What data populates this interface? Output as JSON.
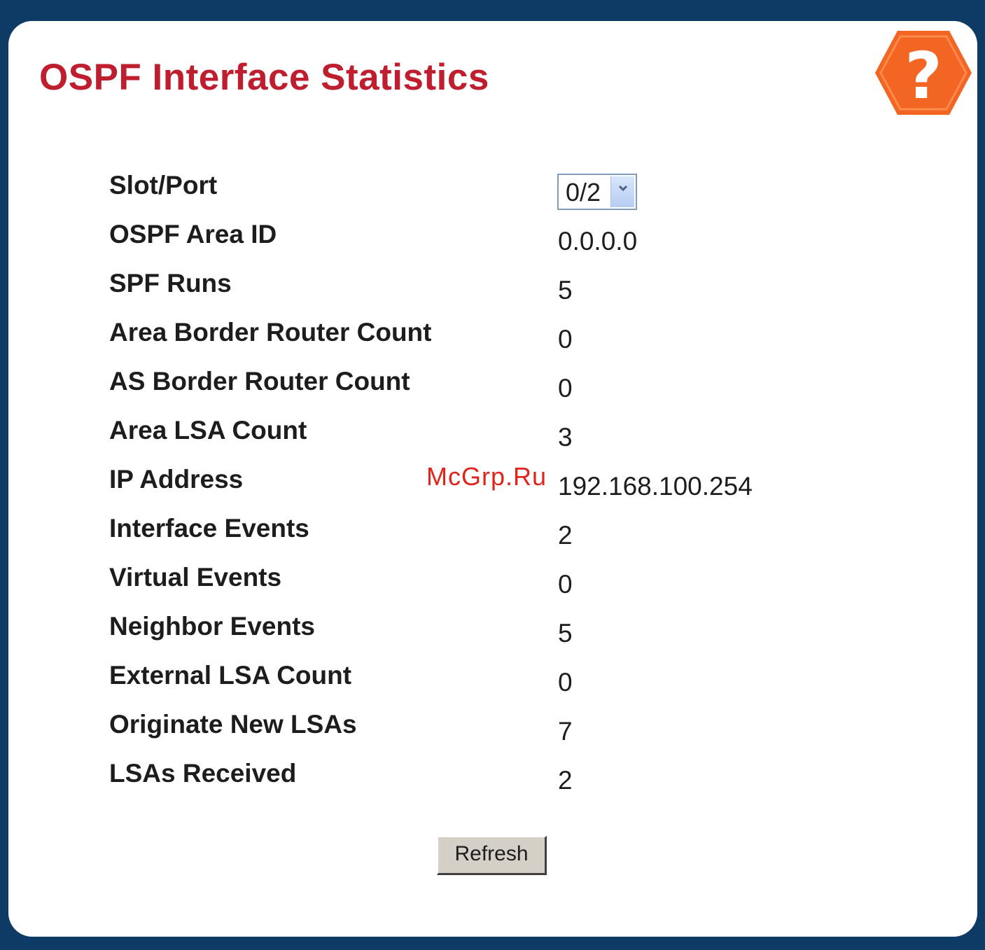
{
  "page": {
    "title": "OSPF Interface Statistics",
    "accent_color": "#bf1e2e",
    "frame_color": "#0e3a66",
    "help_icon": "help-question-icon",
    "help_glyph": "?",
    "help_color": "#f26522"
  },
  "slot_port": {
    "label": "Slot/Port",
    "selected": "0/2"
  },
  "stats": [
    {
      "label": "OSPF Area ID",
      "value": "0.0.0.0"
    },
    {
      "label": "SPF Runs",
      "value": "5"
    },
    {
      "label": "Area Border Router Count",
      "value": "0"
    },
    {
      "label": "AS Border Router Count",
      "value": "0"
    },
    {
      "label": "Area LSA Count",
      "value": "3"
    },
    {
      "label": "IP Address",
      "value": "192.168.100.254"
    },
    {
      "label": "Interface Events",
      "value": "2"
    },
    {
      "label": "Virtual Events",
      "value": "0"
    },
    {
      "label": "Neighbor Events",
      "value": "5"
    },
    {
      "label": "External LSA Count",
      "value": "0"
    },
    {
      "label": "Originate New LSAs",
      "value": "7"
    },
    {
      "label": "LSAs Received",
      "value": "2"
    }
  ],
  "refresh_label": "Refresh",
  "watermark": "McGrp.Ru"
}
